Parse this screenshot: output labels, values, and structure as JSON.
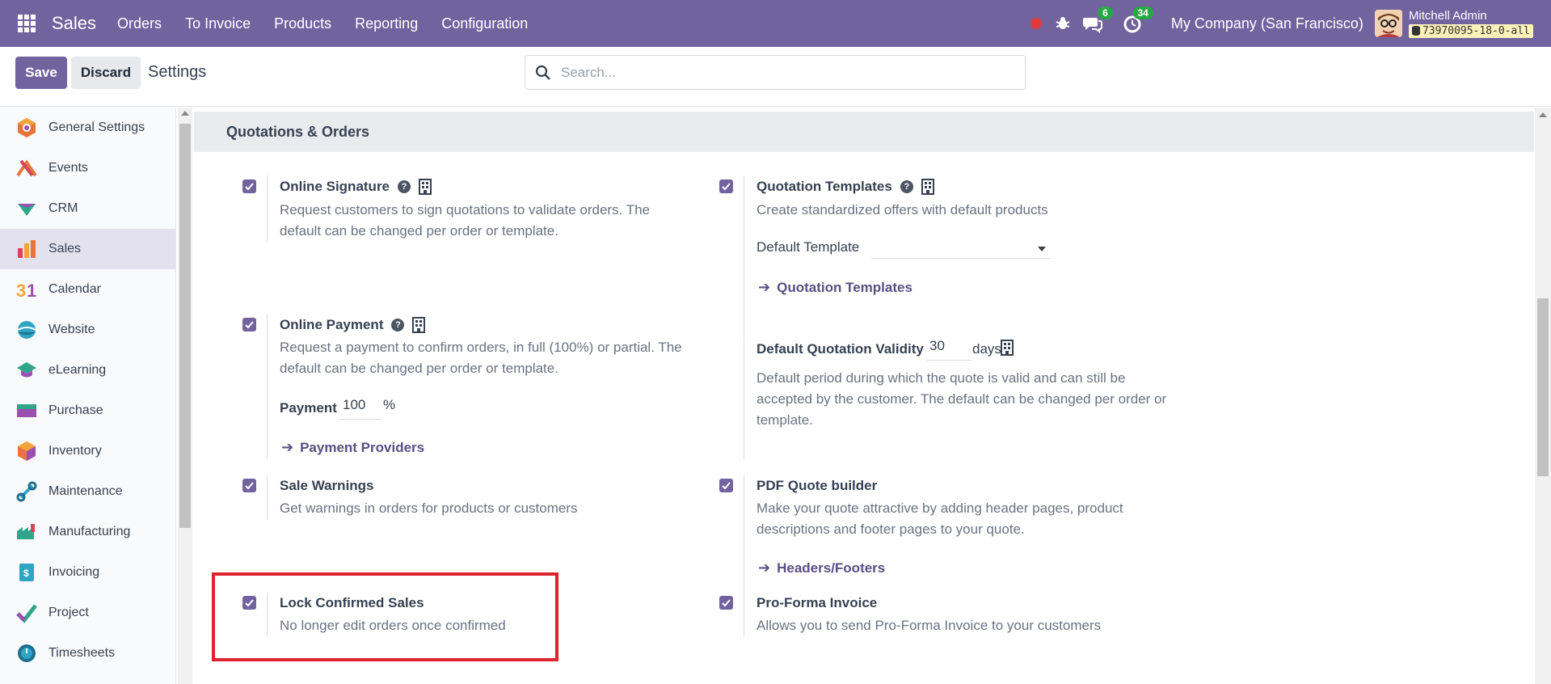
{
  "topbar": {
    "brand": "Sales",
    "menu": [
      "Orders",
      "To Invoice",
      "Products",
      "Reporting",
      "Configuration"
    ],
    "messages_count": "6",
    "activities_count": "34",
    "company": "My Company (San Francisco)",
    "user_name": "Mitchell Admin",
    "db_name": "73970095-18-0-all"
  },
  "control": {
    "save_label": "Save",
    "discard_label": "Discard",
    "title": "Settings",
    "search_placeholder": "Search..."
  },
  "sidebar": {
    "items": [
      {
        "label": "General Settings",
        "icon": "general-settings-icon"
      },
      {
        "label": "Events",
        "icon": "events-icon"
      },
      {
        "label": "CRM",
        "icon": "crm-icon"
      },
      {
        "label": "Sales",
        "icon": "sales-icon"
      },
      {
        "label": "Calendar",
        "icon": "calendar-icon"
      },
      {
        "label": "Website",
        "icon": "website-icon"
      },
      {
        "label": "eLearning",
        "icon": "elearning-icon"
      },
      {
        "label": "Purchase",
        "icon": "purchase-icon"
      },
      {
        "label": "Inventory",
        "icon": "inventory-icon"
      },
      {
        "label": "Maintenance",
        "icon": "maintenance-icon"
      },
      {
        "label": "Manufacturing",
        "icon": "manufacturing-icon"
      },
      {
        "label": "Invoicing",
        "icon": "invoicing-icon"
      },
      {
        "label": "Project",
        "icon": "project-icon"
      },
      {
        "label": "Timesheets",
        "icon": "timesheets-icon"
      }
    ],
    "active": "Sales"
  },
  "section": {
    "title": "Quotations & Orders"
  },
  "settings": {
    "online_signature": {
      "title": "Online Signature",
      "desc": "Request customers to sign quotations to validate orders. The default can be changed per order or template.",
      "checked": true
    },
    "quotation_templates": {
      "title": "Quotation Templates",
      "desc": "Create standardized offers with default products",
      "default_template_label": "Default Template",
      "default_template_value": "",
      "link": "Quotation Templates",
      "checked": true
    },
    "online_payment": {
      "title": "Online Payment",
      "desc": "Request a payment to confirm orders, in full (100%) or partial. The default can be changed per order or template.",
      "payment_label": "Payment",
      "payment_value": "100",
      "payment_unit": "%",
      "link": "Payment Providers",
      "checked": true
    },
    "quotation_validity": {
      "title": "Default Quotation Validity",
      "value": "30",
      "unit": "days",
      "desc": "Default period during which the quote is valid and can still be accepted by the customer. The default can be changed per order or template."
    },
    "sale_warnings": {
      "title": "Sale Warnings",
      "desc": "Get warnings in orders for products or customers",
      "checked": true
    },
    "pdf_quote_builder": {
      "title": "PDF Quote builder",
      "desc": "Make your quote attractive by adding header pages, product descriptions and footer pages to your quote.",
      "link": "Headers/Footers",
      "checked": true
    },
    "lock_confirmed_sales": {
      "title": "Lock Confirmed Sales",
      "desc": "No longer edit orders once confirmed",
      "checked": true
    },
    "pro_forma_invoice": {
      "title": "Pro-Forma Invoice",
      "desc": "Allows you to send Pro-Forma Invoice to your customers",
      "checked": true
    }
  },
  "colors": {
    "brand": "#71639e",
    "highlight": "#e0222d",
    "link": "#5a4f84"
  }
}
